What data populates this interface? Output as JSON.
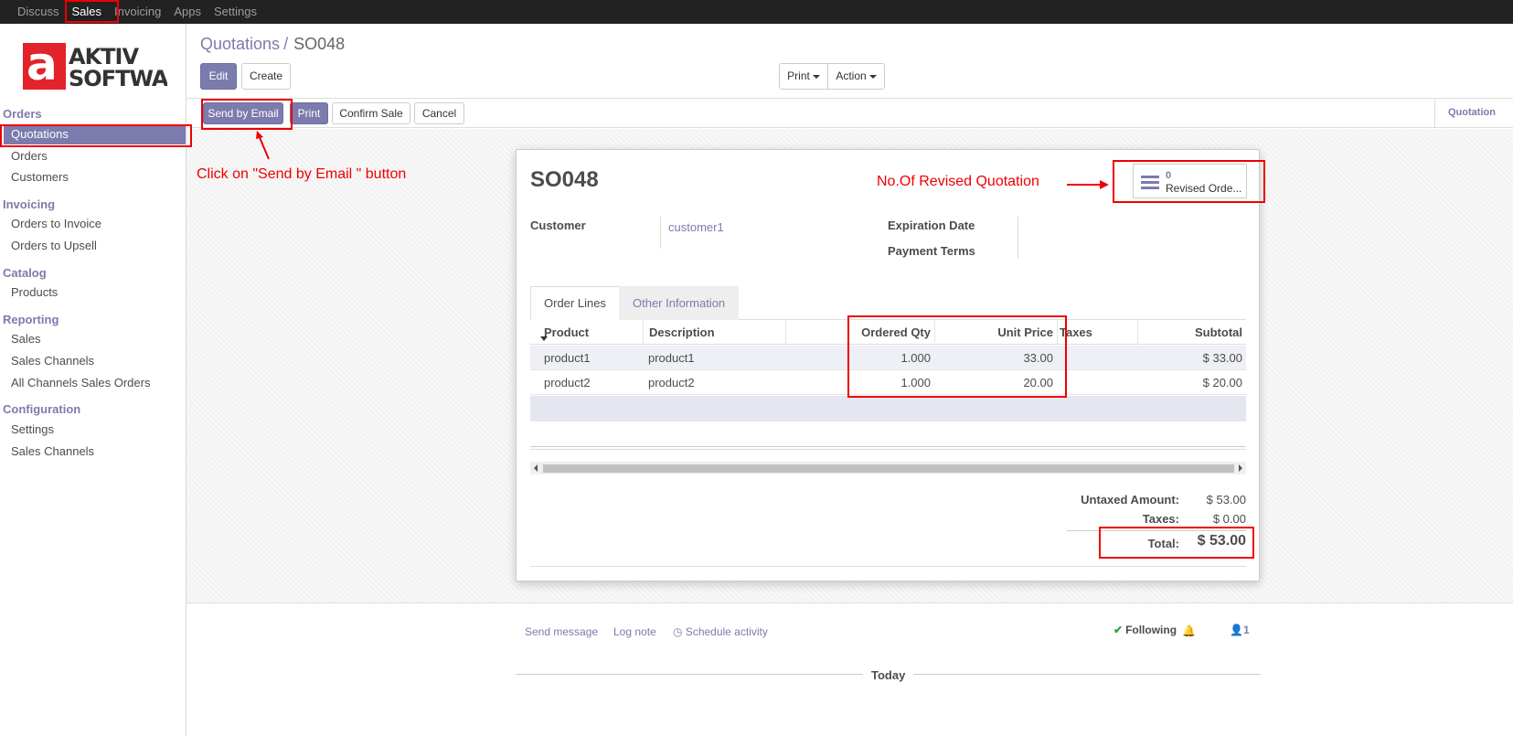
{
  "topnav": [
    "Discuss",
    "Sales",
    "Invoicing",
    "Apps",
    "Settings"
  ],
  "sidebar": {
    "logo_text": [
      "AKTIV",
      "SOFTWARE"
    ],
    "sections": [
      {
        "title": "Orders",
        "items": [
          "Quotations",
          "Orders",
          "Customers"
        ]
      },
      {
        "title": "Invoicing",
        "items": [
          "Orders to Invoice",
          "Orders to Upsell"
        ]
      },
      {
        "title": "Catalog",
        "items": [
          "Products"
        ]
      },
      {
        "title": "Reporting",
        "items": [
          "Sales",
          "Sales Channels",
          "All Channels Sales Orders"
        ]
      },
      {
        "title": "Configuration",
        "items": [
          "Settings",
          "Sales Channels"
        ]
      }
    ],
    "active_item": "Quotations"
  },
  "breadcrumb": {
    "parent": "Quotations",
    "separator": "/",
    "current": "SO048"
  },
  "toolbar": {
    "edit": "Edit",
    "create": "Create",
    "print": "Print",
    "action": "Action"
  },
  "statusbar": {
    "send_email": "Send by Email",
    "print": "Print",
    "confirm": "Confirm Sale",
    "cancel": "Cancel",
    "stage": "Quotation"
  },
  "form": {
    "title": "SO048",
    "stat_button": {
      "count": "0",
      "label": "Revised Orde..."
    },
    "customer_label": "Customer",
    "customer_value": "customer1",
    "expiration_label": "Expiration Date",
    "payment_terms_label": "Payment Terms",
    "tabs": [
      "Order Lines",
      "Other Information"
    ],
    "columns": [
      "Product",
      "Description",
      "Ordered Qty",
      "Unit Price",
      "Taxes",
      "Subtotal"
    ],
    "rows": [
      {
        "product": "product1",
        "description": "product1",
        "qty": "1.000",
        "price": "33.00",
        "taxes": "",
        "subtotal": "$ 33.00"
      },
      {
        "product": "product2",
        "description": "product2",
        "qty": "1.000",
        "price": "20.00",
        "taxes": "",
        "subtotal": "$ 20.00"
      }
    ],
    "totals": {
      "untaxed_label": "Untaxed Amount:",
      "untaxed_value": "$ 53.00",
      "taxes_label": "Taxes:",
      "taxes_value": "$ 0.00",
      "total_label": "Total:",
      "total_value": "$ 53.00"
    }
  },
  "chatter": {
    "send_message": "Send message",
    "log_note": "Log note",
    "schedule": "Schedule activity",
    "following": "Following",
    "followers_count": "1",
    "today": "Today"
  },
  "annotations": {
    "send_email_hint": "Click on \"Send by Email \" button",
    "revised_hint": "No.Of Revised Quotation"
  },
  "colors": {
    "accent": "#7c7bad",
    "annotation": "#ee0000",
    "topbar": "#222222"
  }
}
